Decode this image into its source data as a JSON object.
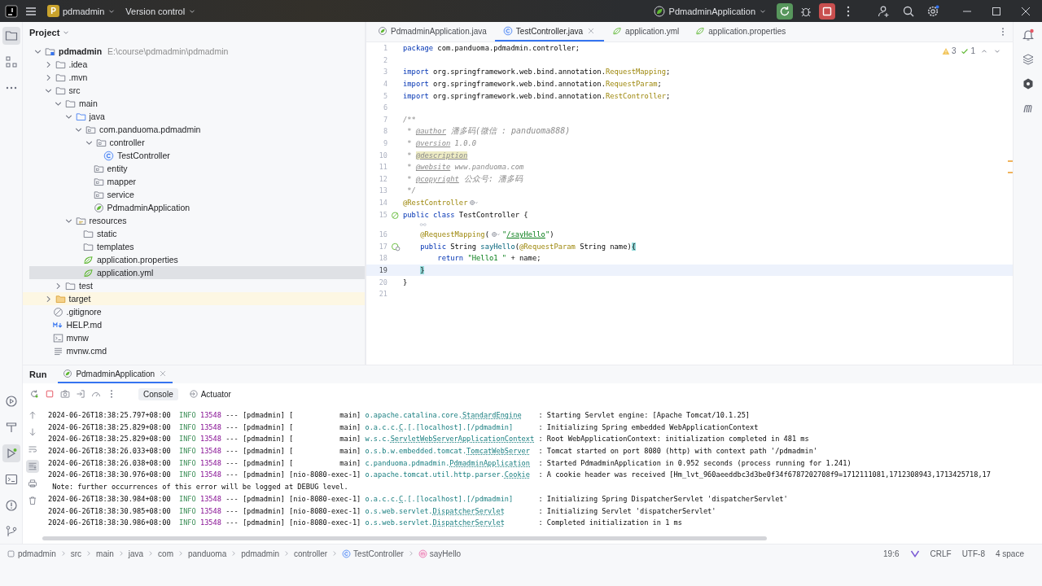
{
  "window": {
    "project_badge": "P",
    "project": "pdmadmin",
    "vcs": "Version control",
    "run_config": "PdmadminApplication"
  },
  "project": {
    "title": "Project",
    "tree": [
      {
        "label": "pdmadmin",
        "path": "E:\\course\\pdmadmin\\pdmadmin",
        "kind": "module",
        "expanded": true,
        "selected": false,
        "children": [
          {
            "label": ".idea",
            "kind": "folder",
            "expanded": false,
            "selected": false
          },
          {
            "label": ".mvn",
            "kind": "folder",
            "expanded": false,
            "selected": false
          },
          {
            "label": "src",
            "kind": "folder",
            "expanded": true,
            "selected": false,
            "children": [
              {
                "label": "main",
                "kind": "folder",
                "expanded": true,
                "selected": false,
                "children": [
                  {
                    "label": "java",
                    "kind": "source",
                    "expanded": true,
                    "selected": false,
                    "children": [
                      {
                        "label": "com.panduoma.pdmadmin",
                        "kind": "package",
                        "expanded": true,
                        "selected": false,
                        "children": [
                          {
                            "label": "controller",
                            "kind": "package",
                            "expanded": true,
                            "selected": false,
                            "children": [
                              {
                                "label": "TestController",
                                "kind": "class",
                                "selected": false
                              }
                            ]
                          },
                          {
                            "label": "entity",
                            "kind": "package",
                            "selected": false
                          },
                          {
                            "label": "mapper",
                            "kind": "package",
                            "selected": false
                          },
                          {
                            "label": "service",
                            "kind": "package",
                            "selected": false
                          },
                          {
                            "label": "PdmadminApplication",
                            "kind": "spring-app",
                            "selected": false
                          }
                        ]
                      }
                    ]
                  },
                  {
                    "label": "resources",
                    "kind": "resources",
                    "expanded": true,
                    "selected": false,
                    "children": [
                      {
                        "label": "static",
                        "kind": "folder",
                        "selected": false
                      },
                      {
                        "label": "templates",
                        "kind": "folder",
                        "selected": false
                      },
                      {
                        "label": "application.properties",
                        "kind": "config",
                        "selected": false
                      },
                      {
                        "label": "application.yml",
                        "kind": "config",
                        "selected": true
                      }
                    ]
                  }
                ]
              },
              {
                "label": "test",
                "kind": "folder",
                "expanded": false,
                "selected": false
              }
            ]
          },
          {
            "label": "target",
            "kind": "excluded-folder",
            "expanded": false,
            "selected": false
          },
          {
            "label": ".gitignore",
            "kind": "ignore",
            "selected": false
          },
          {
            "label": "HELP.md",
            "kind": "markdown",
            "selected": false
          },
          {
            "label": "mvnw",
            "kind": "script",
            "selected": false
          },
          {
            "label": "mvnw.cmd",
            "kind": "text",
            "selected": false
          }
        ]
      }
    ]
  },
  "editor": {
    "tabs": [
      {
        "label": "PdmadminApplication.java",
        "kind": "spring-app",
        "selected": false
      },
      {
        "label": "TestController.java",
        "kind": "class",
        "selected": true
      },
      {
        "label": "application.yml",
        "kind": "config",
        "selected": false
      },
      {
        "label": "application.properties",
        "kind": "config",
        "selected": false
      }
    ],
    "inspections": [
      {
        "kind": "warning",
        "count": "3"
      },
      {
        "kind": "ok",
        "count": "1"
      }
    ],
    "lines": [
      {
        "kind": "code",
        "n": "1",
        "current": false,
        "tokens": [
          {
            "kind": "keyword",
            "text": "package"
          },
          {
            "kind": "plain",
            "text": " com.panduoma.pdmadmin.controller;"
          }
        ]
      },
      {
        "kind": "code",
        "n": "2",
        "current": false
      },
      {
        "kind": "code",
        "n": "3",
        "current": false,
        "tokens": [
          {
            "kind": "keyword",
            "text": "import"
          },
          {
            "kind": "plain",
            "text": " org.springframework.web.bind.annotation."
          },
          {
            "kind": "annotation",
            "text": "RequestMapping"
          },
          {
            "kind": "plain",
            "text": ";"
          }
        ]
      },
      {
        "kind": "code",
        "n": "4",
        "current": false,
        "tokens": [
          {
            "kind": "keyword",
            "text": "import"
          },
          {
            "kind": "plain",
            "text": " org.springframework.web.bind.annotation."
          },
          {
            "kind": "annotation",
            "text": "RequestParam"
          },
          {
            "kind": "plain",
            "text": ";"
          }
        ]
      },
      {
        "kind": "code",
        "n": "5",
        "current": false,
        "tokens": [
          {
            "kind": "keyword",
            "text": "import"
          },
          {
            "kind": "plain",
            "text": " org.springframework.web.bind.annotation."
          },
          {
            "kind": "annotation",
            "text": "RestController"
          },
          {
            "kind": "plain",
            "text": ";"
          }
        ]
      },
      {
        "kind": "code",
        "n": "6",
        "current": false
      },
      {
        "kind": "code",
        "n": "7",
        "current": false,
        "tokens": [
          {
            "kind": "doc",
            "text": "/**"
          }
        ]
      },
      {
        "kind": "code",
        "n": "8",
        "current": false,
        "tokens": [
          {
            "kind": "doc",
            "text": " * "
          },
          {
            "kind": "doctag",
            "text": "@author"
          },
          {
            "kind": "cjk",
            "text": " 潘多码(微信 : panduoma888)"
          }
        ]
      },
      {
        "kind": "code",
        "n": "9",
        "current": false,
        "tokens": [
          {
            "kind": "doc",
            "text": " * "
          },
          {
            "kind": "doctag",
            "text": "@version"
          },
          {
            "kind": "doc",
            "text": " 1.0.0"
          }
        ]
      },
      {
        "kind": "code",
        "n": "10",
        "current": false,
        "tokens": [
          {
            "kind": "doc",
            "text": " * "
          },
          {
            "kind": "doctag-marked",
            "text": "@description"
          }
        ]
      },
      {
        "kind": "code",
        "n": "11",
        "current": false,
        "tokens": [
          {
            "kind": "doc",
            "text": " * "
          },
          {
            "kind": "doctag",
            "text": "@website"
          },
          {
            "kind": "doc",
            "text": " www.panduoma.com"
          }
        ]
      },
      {
        "kind": "code",
        "n": "12",
        "current": false,
        "tokens": [
          {
            "kind": "doc",
            "text": " * "
          },
          {
            "kind": "doctag",
            "text": "@copyright"
          },
          {
            "kind": "cjk",
            "text": " 公众号: 潘多码"
          }
        ]
      },
      {
        "kind": "code",
        "n": "13",
        "current": false,
        "tokens": [
          {
            "kind": "doc",
            "text": " */"
          }
        ]
      },
      {
        "kind": "code",
        "n": "14",
        "current": false,
        "tokens": [
          {
            "kind": "annotation",
            "text": "@RestController"
          },
          {
            "kind": "globe"
          }
        ]
      },
      {
        "kind": "code",
        "n": "15",
        "current": false,
        "gutter": {
          "kind": "bean"
        },
        "tokens": [
          {
            "kind": "keyword",
            "text": "public class"
          },
          {
            "kind": "plain",
            "text": " TestController {"
          }
        ]
      },
      {
        "kind": "hint",
        "current": false
      },
      {
        "kind": "code",
        "n": "16",
        "current": false,
        "tokens": [
          {
            "kind": "annotation",
            "text": "    @RequestMapping"
          },
          {
            "kind": "plain",
            "text": "("
          },
          {
            "kind": "globe"
          },
          {
            "kind": "string",
            "text": "\""
          },
          {
            "kind": "url",
            "text": "/sayHello"
          },
          {
            "kind": "string",
            "text": "\""
          },
          {
            "kind": "plain",
            "text": ")"
          }
        ]
      },
      {
        "kind": "code",
        "n": "17",
        "current": false,
        "gutter": {
          "kind": "bean-web"
        },
        "tokens": [
          {
            "kind": "keyword",
            "text": "    public"
          },
          {
            "kind": "plain",
            "text": " String "
          },
          {
            "kind": "method",
            "text": "sayHello"
          },
          {
            "kind": "plain",
            "text": "("
          },
          {
            "kind": "annotation",
            "text": "@RequestParam"
          },
          {
            "kind": "plain",
            "text": " String name)"
          },
          {
            "kind": "brace",
            "text": "{"
          }
        ]
      },
      {
        "kind": "code",
        "n": "18",
        "current": false,
        "tokens": [
          {
            "kind": "keyword",
            "text": "        return"
          },
          {
            "kind": "string",
            "text": " \"Hello1 \""
          },
          {
            "kind": "plain",
            "text": " + name;"
          }
        ]
      },
      {
        "kind": "code",
        "n": "19",
        "current": true,
        "tokens": [
          {
            "kind": "brace",
            "text": "    }"
          }
        ]
      },
      {
        "kind": "code",
        "n": "20",
        "current": false,
        "tokens": [
          {
            "kind": "plain",
            "text": "}"
          }
        ]
      },
      {
        "kind": "code",
        "n": "21",
        "current": false
      }
    ]
  },
  "run": {
    "title": "Run",
    "tabs": [
      {
        "label": "PdmadminApplication",
        "selected": true
      }
    ],
    "views": [
      {
        "label": "Console",
        "kind": "console",
        "selected": true
      },
      {
        "label": "Actuator",
        "kind": "actuator",
        "selected": false
      }
    ],
    "console": [
      {
        "kind": "log",
        "time": "2024-06-26T18:38:25.797+08:00",
        "level": "INFO",
        "pid": "13548",
        "sep": "---",
        "app": "[pdmadmin]",
        "thread": "[           main]",
        "logger": [
          {
            "t": "o.apache.catalina.core.",
            "link": false
          },
          {
            "t": "StandardEngine",
            "link": true
          }
        ],
        "message": ": Starting Servlet engine: [Apache Tomcat/10.1.25]"
      },
      {
        "kind": "log",
        "time": "2024-06-26T18:38:25.829+08:00",
        "level": "INFO",
        "pid": "13548",
        "sep": "---",
        "app": "[pdmadmin]",
        "thread": "[           main]",
        "logger": [
          {
            "t": "o.a.c.c.",
            "link": false
          },
          {
            "t": "C",
            "link": true
          },
          {
            "t": ".[.[localhost].[/pdmadmin]",
            "link": false
          }
        ],
        "message": ": Initializing Spring embedded WebApplicationContext"
      },
      {
        "kind": "log",
        "time": "2024-06-26T18:38:25.829+08:00",
        "level": "INFO",
        "pid": "13548",
        "sep": "---",
        "app": "[pdmadmin]",
        "thread": "[           main]",
        "logger": [
          {
            "t": "w.s.c.",
            "link": false
          },
          {
            "t": "ServletWebServerApplicationContext",
            "link": true
          }
        ],
        "message": ": Root WebApplicationContext: initialization completed in 481 ms"
      },
      {
        "kind": "log",
        "time": "2024-06-26T18:38:26.033+08:00",
        "level": "INFO",
        "pid": "13548",
        "sep": "---",
        "app": "[pdmadmin]",
        "thread": "[           main]",
        "logger": [
          {
            "t": "o.s.b.w.embedded.tomcat.",
            "link": false
          },
          {
            "t": "TomcatWebServer",
            "link": true
          }
        ],
        "message": ": Tomcat started on port 8080 (http) with context path '/pdmadmin'"
      },
      {
        "kind": "log",
        "time": "2024-06-26T18:38:26.038+08:00",
        "level": "INFO",
        "pid": "13548",
        "sep": "---",
        "app": "[pdmadmin]",
        "thread": "[           main]",
        "logger": [
          {
            "t": "c.panduoma.pdmadmin.",
            "link": false
          },
          {
            "t": "PdmadminApplication",
            "link": true
          }
        ],
        "message": ": Started PdmadminApplication in 0.952 seconds (process running for 1.241)"
      },
      {
        "kind": "log",
        "time": "2024-06-26T18:38:30.976+08:00",
        "level": "INFO",
        "pid": "13548",
        "sep": "---",
        "app": "[pdmadmin]",
        "thread": "[nio-8080-exec-1]",
        "logger": [
          {
            "t": "o.apache.tomcat.util.http.parser.",
            "link": false
          },
          {
            "t": "Cookie",
            "link": true
          }
        ],
        "message": ": A cookie header was received [Hm_lvt_960aeeddbc3d3be0f34f6787202708f9=1712111081,1712308943,1713425718,17"
      },
      {
        "kind": "note",
        "text": "Note: further occurrences of this error will be logged at DEBUG level."
      },
      {
        "kind": "log",
        "time": "2024-06-26T18:38:30.984+08:00",
        "level": "INFO",
        "pid": "13548",
        "sep": "---",
        "app": "[pdmadmin]",
        "thread": "[nio-8080-exec-1]",
        "logger": [
          {
            "t": "o.a.c.c.",
            "link": false
          },
          {
            "t": "C",
            "link": true
          },
          {
            "t": ".[.[localhost].[/pdmadmin]",
            "link": false
          }
        ],
        "message": ": Initializing Spring DispatcherServlet 'dispatcherServlet'"
      },
      {
        "kind": "log",
        "time": "2024-06-26T18:38:30.985+08:00",
        "level": "INFO",
        "pid": "13548",
        "sep": "---",
        "app": "[pdmadmin]",
        "thread": "[nio-8080-exec-1]",
        "logger": [
          {
            "t": "o.s.web.servlet.",
            "link": false
          },
          {
            "t": "DispatcherServlet",
            "link": true
          }
        ],
        "message": ": Initializing Servlet 'dispatcherServlet'"
      },
      {
        "kind": "log",
        "time": "2024-06-26T18:38:30.986+08:00",
        "level": "INFO",
        "pid": "13548",
        "sep": "---",
        "app": "[pdmadmin]",
        "thread": "[nio-8080-exec-1]",
        "logger": [
          {
            "t": "o.s.web.servlet.",
            "link": false
          },
          {
            "t": "DispatcherServlet",
            "link": true
          }
        ],
        "message": ": Completed initialization in 1 ms"
      }
    ]
  },
  "status_bar": {
    "breadcrumbs": [
      {
        "label": "pdmadmin",
        "kind": "module"
      },
      {
        "label": "src",
        "kind": "plain"
      },
      {
        "label": "main",
        "kind": "plain"
      },
      {
        "label": "java",
        "kind": "plain"
      },
      {
        "label": "com",
        "kind": "plain"
      },
      {
        "label": "panduoma",
        "kind": "plain"
      },
      {
        "label": "pdmadmin",
        "kind": "plain"
      },
      {
        "label": "controller",
        "kind": "plain"
      },
      {
        "label": "TestController",
        "kind": "class"
      },
      {
        "label": "sayHello",
        "kind": "method"
      }
    ],
    "position": "19:6",
    "line_separator": "CRLF",
    "encoding": "UTF-8",
    "indent": "4 space"
  }
}
